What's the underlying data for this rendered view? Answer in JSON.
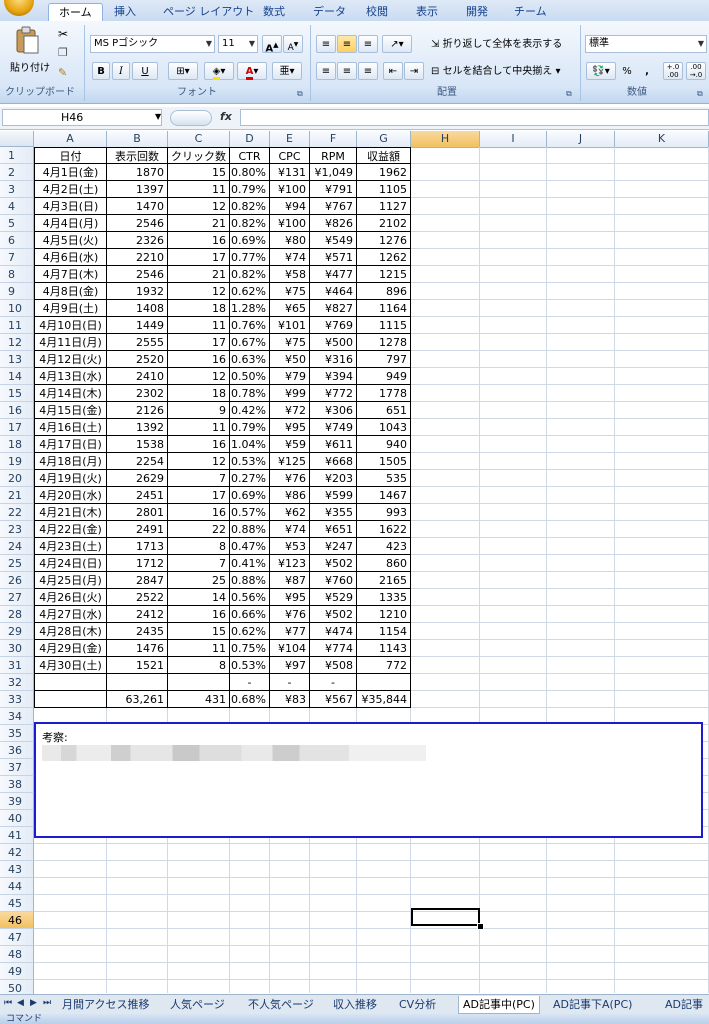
{
  "ribbon": {
    "tabs": [
      "ホーム",
      "挿入",
      "ページ レイアウト",
      "数式",
      "データ",
      "校閲",
      "表示",
      "開発",
      "チーム"
    ],
    "clipboard": {
      "paste_label": "貼り付け",
      "group_label": "クリップボード"
    },
    "font": {
      "family": "MS Pゴシック",
      "size": "11",
      "group_label": "フォント",
      "bold": "B",
      "italic": "I",
      "underline": "U"
    },
    "alignment": {
      "wrap_text": "折り返して全体を表示する",
      "merge_center": "セルを結合して中央揃え",
      "group_label": "配置"
    },
    "number": {
      "format": "標準",
      "percent": "%",
      "comma": ",",
      "group_label": "数値",
      "inc_decimal": "+.0 .00",
      "dec_decimal": ".00 →.0"
    }
  },
  "formula_bar": {
    "name_box": "H46",
    "fx": "fx",
    "formula": ""
  },
  "columns": [
    "A",
    "B",
    "C",
    "D",
    "E",
    "F",
    "G",
    "H",
    "I",
    "J",
    "K"
  ],
  "selected_column": "H",
  "selected_row": "46",
  "table": {
    "headers": [
      "日付",
      "表示回数",
      "クリック数",
      "CTR",
      "CPC",
      "RPM",
      "収益額"
    ],
    "rows": [
      [
        "4月1日(金)",
        "1870",
        "15",
        "0.80%",
        "¥131",
        "¥1,049",
        "1962"
      ],
      [
        "4月2日(土)",
        "1397",
        "11",
        "0.79%",
        "¥100",
        "¥791",
        "1105"
      ],
      [
        "4月3日(日)",
        "1470",
        "12",
        "0.82%",
        "¥94",
        "¥767",
        "1127"
      ],
      [
        "4月4日(月)",
        "2546",
        "21",
        "0.82%",
        "¥100",
        "¥826",
        "2102"
      ],
      [
        "4月5日(火)",
        "2326",
        "16",
        "0.69%",
        "¥80",
        "¥549",
        "1276"
      ],
      [
        "4月6日(水)",
        "2210",
        "17",
        "0.77%",
        "¥74",
        "¥571",
        "1262"
      ],
      [
        "4月7日(木)",
        "2546",
        "21",
        "0.82%",
        "¥58",
        "¥477",
        "1215"
      ],
      [
        "4月8日(金)",
        "1932",
        "12",
        "0.62%",
        "¥75",
        "¥464",
        "896"
      ],
      [
        "4月9日(土)",
        "1408",
        "18",
        "1.28%",
        "¥65",
        "¥827",
        "1164"
      ],
      [
        "4月10日(日)",
        "1449",
        "11",
        "0.76%",
        "¥101",
        "¥769",
        "1115"
      ],
      [
        "4月11日(月)",
        "2555",
        "17",
        "0.67%",
        "¥75",
        "¥500",
        "1278"
      ],
      [
        "4月12日(火)",
        "2520",
        "16",
        "0.63%",
        "¥50",
        "¥316",
        "797"
      ],
      [
        "4月13日(水)",
        "2410",
        "12",
        "0.50%",
        "¥79",
        "¥394",
        "949"
      ],
      [
        "4月14日(木)",
        "2302",
        "18",
        "0.78%",
        "¥99",
        "¥772",
        "1778"
      ],
      [
        "4月15日(金)",
        "2126",
        "9",
        "0.42%",
        "¥72",
        "¥306",
        "651"
      ],
      [
        "4月16日(土)",
        "1392",
        "11",
        "0.79%",
        "¥95",
        "¥749",
        "1043"
      ],
      [
        "4月17日(日)",
        "1538",
        "16",
        "1.04%",
        "¥59",
        "¥611",
        "940"
      ],
      [
        "4月18日(月)",
        "2254",
        "12",
        "0.53%",
        "¥125",
        "¥668",
        "1505"
      ],
      [
        "4月19日(火)",
        "2629",
        "7",
        "0.27%",
        "¥76",
        "¥203",
        "535"
      ],
      [
        "4月20日(水)",
        "2451",
        "17",
        "0.69%",
        "¥86",
        "¥599",
        "1467"
      ],
      [
        "4月21日(木)",
        "2801",
        "16",
        "0.57%",
        "¥62",
        "¥355",
        "993"
      ],
      [
        "4月22日(金)",
        "2491",
        "22",
        "0.88%",
        "¥74",
        "¥651",
        "1622"
      ],
      [
        "4月23日(土)",
        "1713",
        "8",
        "0.47%",
        "¥53",
        "¥247",
        "423"
      ],
      [
        "4月24日(日)",
        "1712",
        "7",
        "0.41%",
        "¥123",
        "¥502",
        "860"
      ],
      [
        "4月25日(月)",
        "2847",
        "25",
        "0.88%",
        "¥87",
        "¥760",
        "2165"
      ],
      [
        "4月26日(火)",
        "2522",
        "14",
        "0.56%",
        "¥95",
        "¥529",
        "1335"
      ],
      [
        "4月27日(水)",
        "2412",
        "16",
        "0.66%",
        "¥76",
        "¥502",
        "1210"
      ],
      [
        "4月28日(木)",
        "2435",
        "15",
        "0.62%",
        "¥77",
        "¥474",
        "1154"
      ],
      [
        "4月29日(金)",
        "1476",
        "11",
        "0.75%",
        "¥104",
        "¥774",
        "1143"
      ],
      [
        "4月30日(土)",
        "1521",
        "8",
        "0.53%",
        "¥97",
        "¥508",
        "772"
      ]
    ],
    "row32": [
      "",
      "",
      "",
      "-",
      "-",
      "-",
      ""
    ],
    "totals": [
      "",
      "63,261",
      "431",
      "0.68%",
      "¥83",
      "¥567",
      "¥35,844"
    ]
  },
  "notes": {
    "label": "考察:"
  },
  "sheet_tabs": [
    "月間アクセス推移",
    "人気ページ",
    "不人気ページ",
    "収入推移",
    "CV分析",
    "AD記事中(PC)",
    "AD記事下A(PC)",
    "AD記事"
  ],
  "active_sheet": "AD記事中(PC)",
  "status": {
    "mode": "コマンド"
  }
}
